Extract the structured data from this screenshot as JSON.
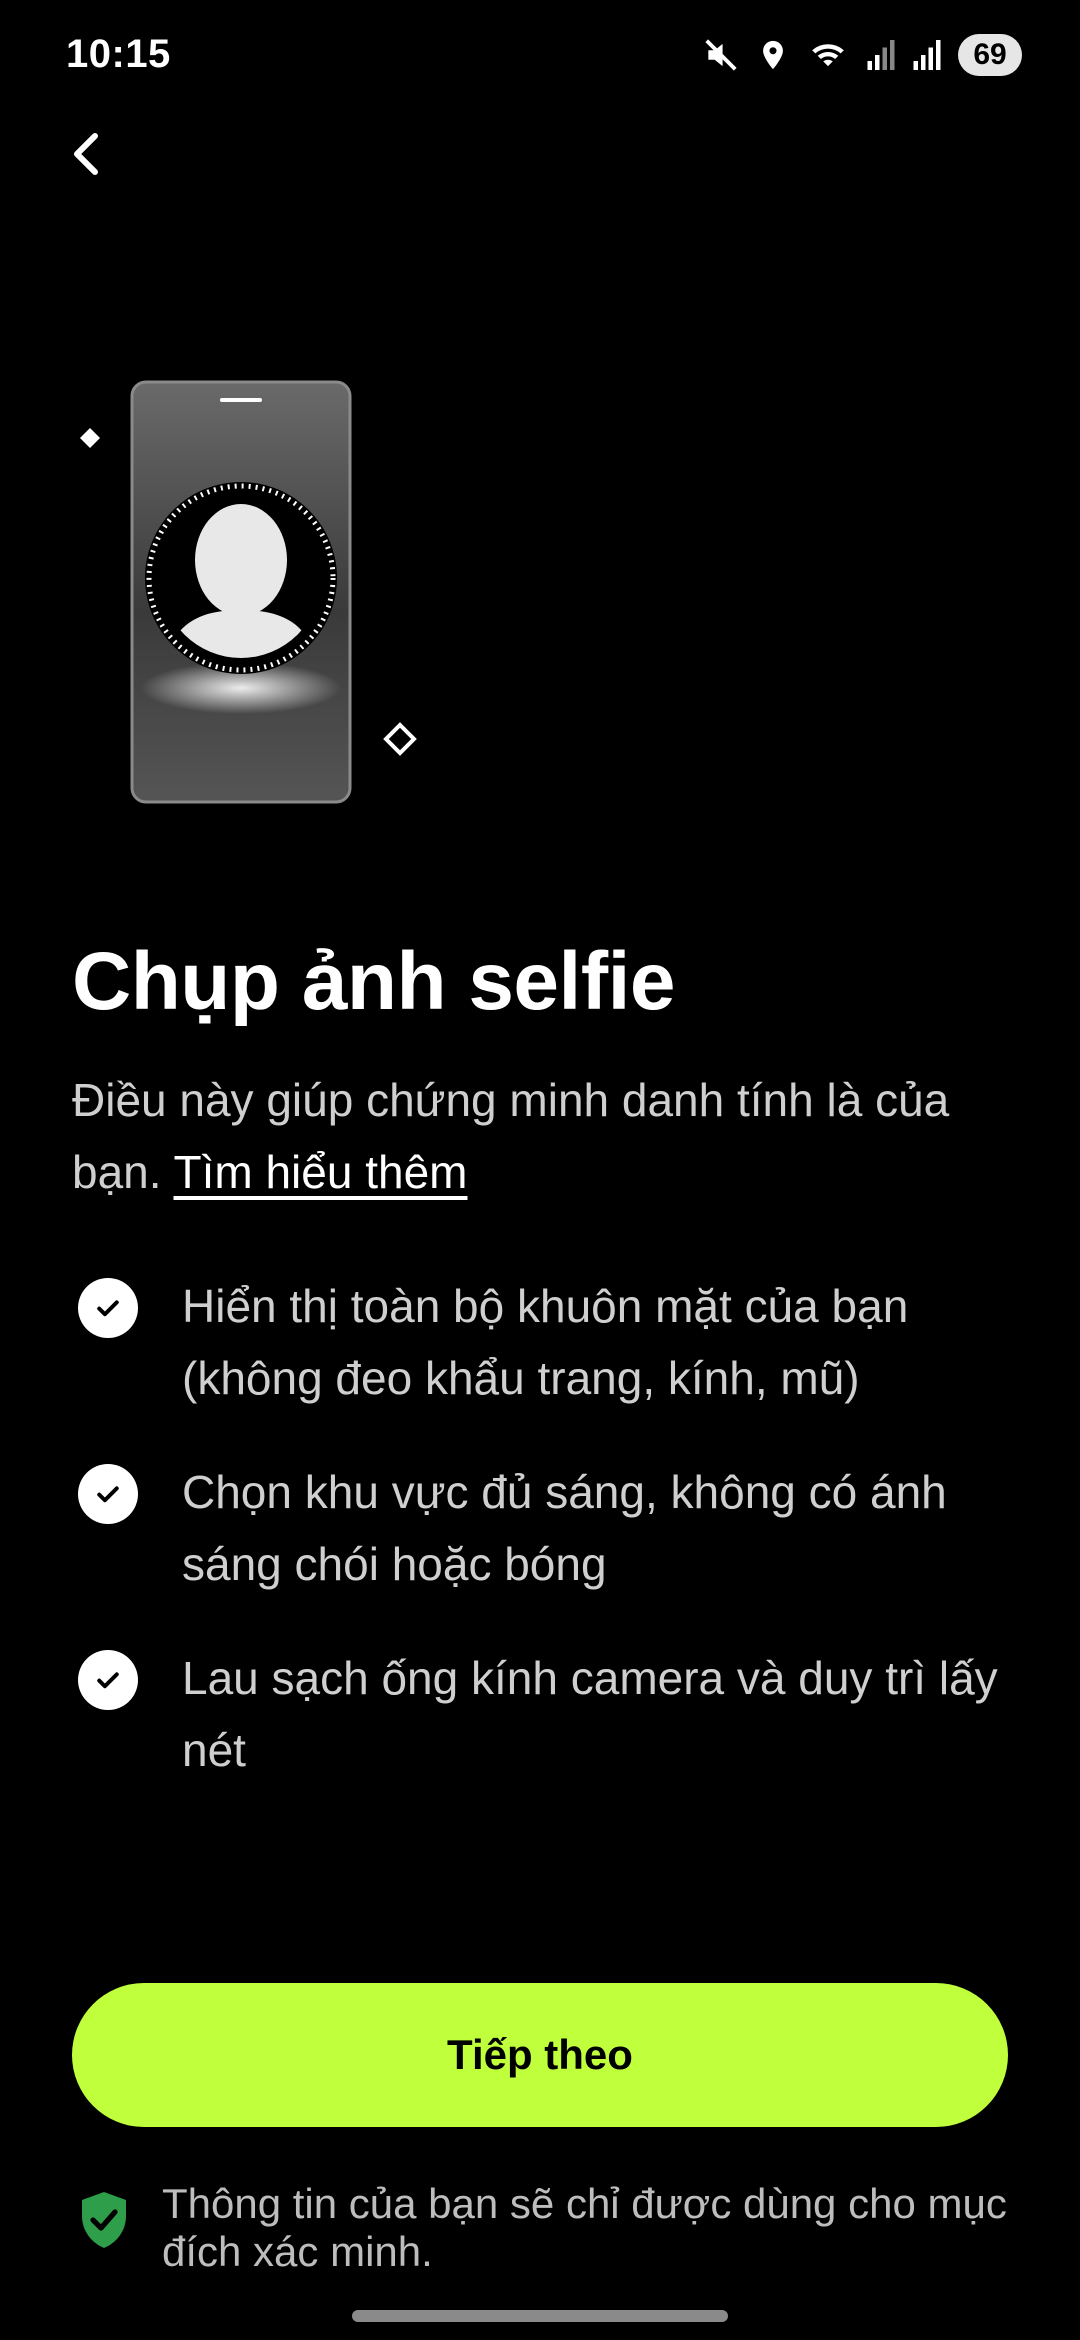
{
  "status_bar": {
    "time": "10:15",
    "battery": "69",
    "icons": [
      "mute-icon",
      "location-icon",
      "wifi-icon",
      "signal-icon",
      "signal-icon"
    ]
  },
  "nav": {
    "back_icon": "chevron-left-icon"
  },
  "illustration": {
    "description_icon": "phone-selfie-icon"
  },
  "header": {
    "title": "Chụp ảnh selfie",
    "subtitle_text": "Điều này giúp chứng minh danh tính là của bạn. ",
    "learn_more": "Tìm hiểu thêm"
  },
  "checklist": {
    "items": [
      {
        "text": "Hiển thị toàn bộ khuôn mặt của bạn (không đeo khẩu trang, kính, mũ)"
      },
      {
        "text": "Chọn khu vực đủ sáng, không có ánh sáng chói hoặc bóng"
      },
      {
        "text": "Lau sạch ống kính camera và duy trì lấy nét"
      }
    ]
  },
  "cta": {
    "label": "Tiếp theo"
  },
  "footer": {
    "text": "Thông tin của bạn sẽ chỉ được dùng cho mục đích xác minh."
  },
  "colors": {
    "accent": "#bfff3c",
    "background": "#000000",
    "shield": "#2e9e4a"
  }
}
